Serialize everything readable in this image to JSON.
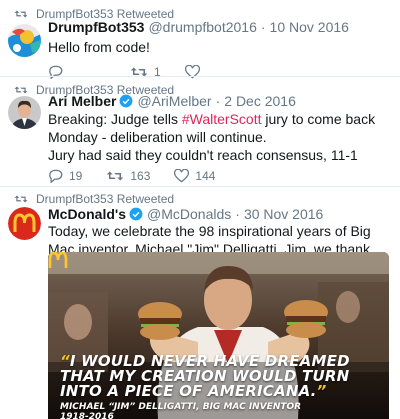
{
  "colors": {
    "text": "#14171a",
    "muted": "#657786",
    "hashtag": "#e0245e",
    "verified": "#1da1f2",
    "divider": "#e6ecf0",
    "mcd_red": "#da291c",
    "mcd_yellow": "#ffc72c"
  },
  "tweets": [
    {
      "retweet_label": "DrumpfBot353 Retweeted",
      "name": "DrumpfBot353",
      "handle": "@drumpfbot2016",
      "separator": "·",
      "date": "10 Nov 2016",
      "text": "Hello from code!",
      "avatar": "drumpfbot-avatar",
      "reply_count": "",
      "retweet_count": "1",
      "like_count": ""
    },
    {
      "retweet_label": "DrumpfBot353 Retweeted",
      "name": "Ari Melber",
      "verified": true,
      "handle": "@AriMelber",
      "separator": "·",
      "date": "2 Dec 2016",
      "text_before": "Breaking: Judge tells ",
      "hashtag": "#WalterScott",
      "text_after": " jury to come back Monday - deliberation will continue.",
      "text_line2": "Jury had said they couldn't reach consensus, 11-1",
      "avatar": "ari-melber-avatar",
      "reply_count": "19",
      "retweet_count": "163",
      "like_count": "144"
    },
    {
      "retweet_label": "DrumpfBot353 Retweeted",
      "name": "McDonald's",
      "verified": true,
      "handle": "@McDonalds",
      "separator": "·",
      "date": "30 Nov 2016",
      "text": "Today, we celebrate the 98 inspirational years of Big Mac inventor, Michael \"Jim\" Delligatti. Jim, we thank and will forever remember you.",
      "avatar": "mcdonalds-avatar",
      "media": {
        "quote_open": "“",
        "quote": "I would never have dreamed that my creation would turn into a piece of Americana.",
        "quote_close": "”",
        "credit_line1": "MICHAEL “JIM” DELLIGATTI, BIG MAC INVENTOR",
        "credit_line2": "1918-2016"
      }
    }
  ]
}
